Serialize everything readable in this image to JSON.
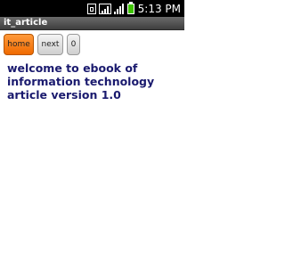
{
  "status_bar": {
    "time": "5:13 PM",
    "icons": [
      "sim-icon",
      "wifi-icon",
      "signal-icon",
      "battery-icon"
    ]
  },
  "app": {
    "title": "it_article"
  },
  "toolbar": {
    "home_label": "home",
    "next_label": "next",
    "page_label": "0"
  },
  "content": {
    "text": "welcome to ebook of information technology article version 1.0"
  },
  "colors": {
    "accent": "#ef6a00",
    "content_text": "#1a1a6e"
  }
}
